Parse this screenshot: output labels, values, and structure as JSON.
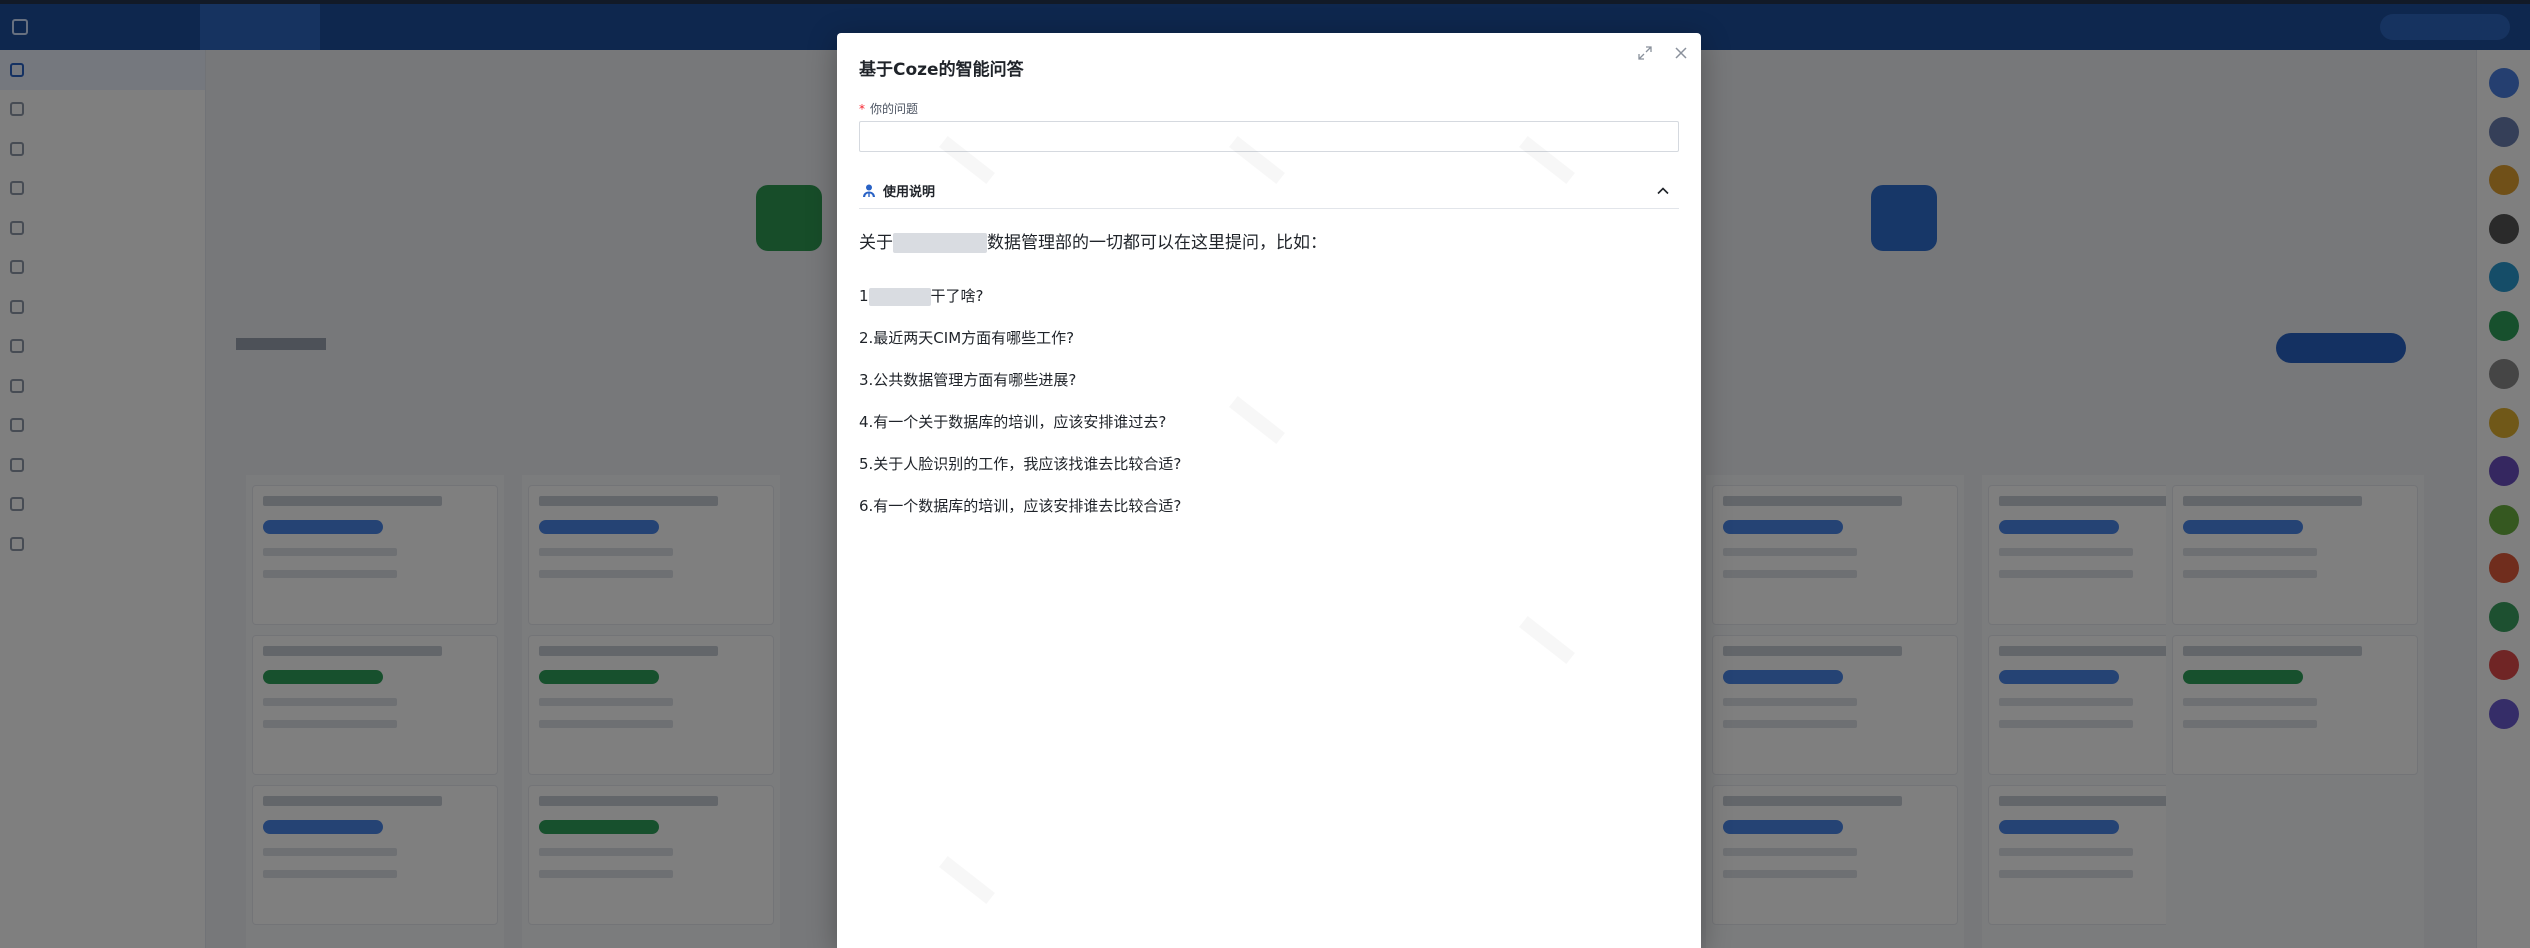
{
  "modal": {
    "title": "基于Coze的智能问答",
    "question_label": "你的问题",
    "question_required_mark": "*",
    "question_value": "",
    "usage_section_label": "使用说明",
    "usage_intro_before": "关于",
    "usage_intro_after": "数据管理部的一切都可以在这里提问，比如：",
    "examples": [
      {
        "prefix": "1",
        "text": "干了啥?"
      },
      {
        "prefix": "",
        "text": "2.最近两天CIM方面有哪些工作?"
      },
      {
        "prefix": "",
        "text": "3.公共数据管理方面有哪些进展?"
      },
      {
        "prefix": "",
        "text": "4.有一个关于数据库的培训，应该安排谁过去?"
      },
      {
        "prefix": "",
        "text": "5.关于人脸识别的工作，我应该找谁去比较合适?"
      },
      {
        "prefix": "",
        "text": "6.有一个数据库的培训，应该安排谁去比较合适?"
      }
    ]
  },
  "colors": {
    "topbar": "#1c4f9c",
    "accent": "#2962c5",
    "required": "#f5222d",
    "overlay": "rgba(0,0,0,0.5)"
  },
  "icons": {
    "expand": "expand-icon",
    "close": "close-icon",
    "usage": "people-icon",
    "collapse": "chevron-up-icon"
  }
}
